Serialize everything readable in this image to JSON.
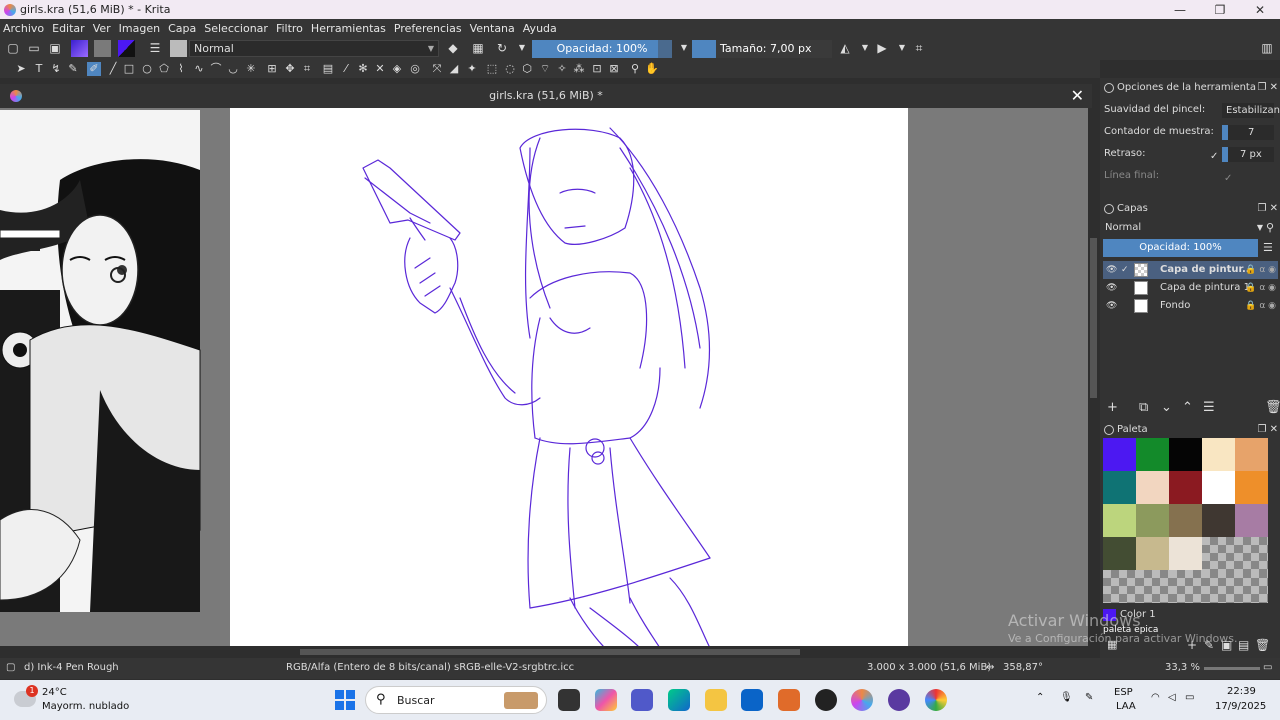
{
  "window": {
    "title": "girls.kra (51,6 MiB) * - Krita",
    "minimize": "—",
    "maximize": "❐",
    "close": "✕"
  },
  "menu": [
    "Archivo",
    "Editar",
    "Ver",
    "Imagen",
    "Capa",
    "Seleccionar",
    "Filtro",
    "Herramientas",
    "Preferencias",
    "Ventana",
    "Ayuda"
  ],
  "toolbar": {
    "blend_mode": "Normal",
    "opacity_label": "Opacidad: 100%",
    "opacity_value": 100,
    "size_label": "Tamaño: 7,00 px",
    "size_value": 7
  },
  "document": {
    "tab_title": "girls.kra (51,6 MiB) *"
  },
  "tool_options": {
    "title": "Opciones de la herramienta",
    "rows": [
      {
        "label": "Suavidad del pincel:",
        "value": "Estabilizant"
      },
      {
        "label": "Contador de muestra:",
        "value": "7"
      },
      {
        "label": "Retraso:",
        "value": "7 px"
      },
      {
        "label": "Línea final:",
        "value": ""
      }
    ]
  },
  "layers": {
    "title": "Capas",
    "blend_mode": "Normal",
    "opacity_label": "Opacidad:  100%",
    "items": [
      {
        "name": "Capa de pintur...",
        "selected": true
      },
      {
        "name": "Capa de pintura 1",
        "selected": false
      },
      {
        "name": "Fondo",
        "selected": false
      }
    ]
  },
  "palette": {
    "title": "Paleta",
    "colors": [
      "#4c18f2",
      "#138a2a",
      "#050505",
      "#f9e6c2",
      "#e7a36a",
      "#0f7374",
      "#f2d6c0",
      "#8b1a21",
      "#ffffff",
      "#ee8f2a",
      "#bcd57d",
      "#8c9a5d",
      "#85714f",
      "#3f3731",
      "#a77ca4",
      "#434d33",
      "#c7b98e",
      "#ece3d7",
      "checker",
      "checker"
    ],
    "current_color_label": "Color 1",
    "palette_name": "paleta epica"
  },
  "status": {
    "brush": "d) Ink-4 Pen Rough",
    "color_space": "RGB/Alfa (Entero de 8 bits/canal)  sRGB-elle-V2-srgbtrc.icc",
    "dimensions": "3.000 x 3.000 (51,6 MiB)",
    "rotation": "358,87°",
    "zoom": "33,3 %"
  },
  "watermark": {
    "line1": "Activar Windows",
    "line2": "Ve a Configuración para activar Windows."
  },
  "taskbar": {
    "weather_temp": "24°C",
    "weather_desc": "Mayorm. nublado",
    "weather_badge": "1",
    "search_placeholder": "Buscar",
    "lang1": "ESP",
    "lang2": "LAA",
    "time": "22:39",
    "date": "17/9/2025"
  }
}
